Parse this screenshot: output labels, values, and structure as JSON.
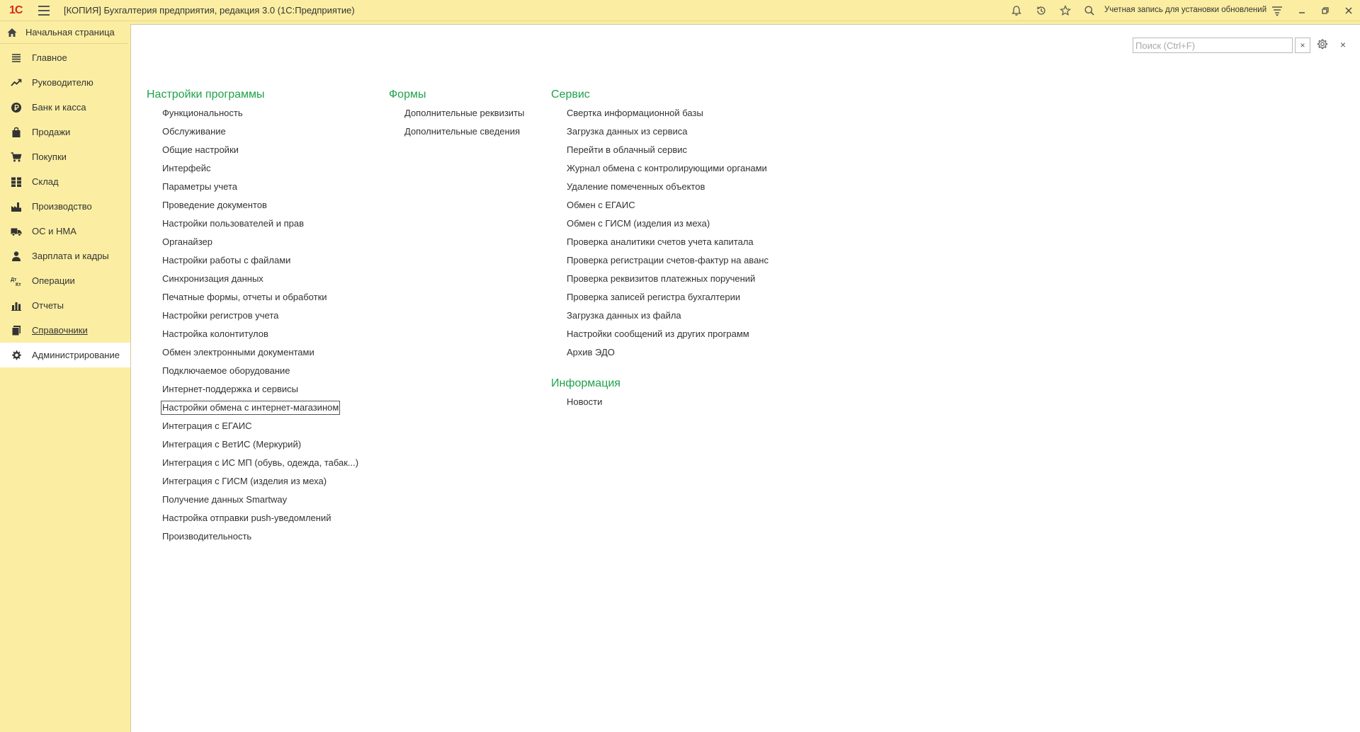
{
  "titlebar": {
    "logo": "1С",
    "title": "[КОПИЯ] Бухгалтерия предприятия, редакция 3.0  (1С:Предприятие)",
    "account": "Учетная запись для установки обновлений"
  },
  "home": {
    "label": "Начальная страница"
  },
  "sidebar": {
    "items": [
      {
        "label": "Главное",
        "icon": "menu-lines-icon"
      },
      {
        "label": "Руководителю",
        "icon": "trend-up-icon"
      },
      {
        "label": "Банк и касса",
        "icon": "ruble-coin-icon"
      },
      {
        "label": "Продажи",
        "icon": "shopping-bag-icon"
      },
      {
        "label": "Покупки",
        "icon": "cart-icon"
      },
      {
        "label": "Склад",
        "icon": "warehouse-grid-icon"
      },
      {
        "label": "Производство",
        "icon": "factory-icon"
      },
      {
        "label": "ОС и НМА",
        "icon": "truck-icon"
      },
      {
        "label": "Зарплата и кадры",
        "icon": "person-icon"
      },
      {
        "label": "Операции",
        "icon": "dt-kt-icon"
      },
      {
        "label": "Отчеты",
        "icon": "bar-chart-icon"
      },
      {
        "label": "Справочники",
        "icon": "books-icon"
      },
      {
        "label": "Администрирование",
        "icon": "gear-icon"
      }
    ],
    "active_index": 12
  },
  "panel": {
    "search_placeholder": "Поиск (Ctrl+F)",
    "search_value": "",
    "clear_symbol": "×",
    "close_symbol": "×"
  },
  "sections": {
    "settings": {
      "title": "Настройки программы",
      "items": [
        "Функциональность",
        "Обслуживание",
        "Общие настройки",
        "Интерфейс",
        "Параметры учета",
        "Проведение документов",
        "Настройки пользователей и прав",
        "Органайзер",
        "Настройки работы с файлами",
        "Синхронизация данных",
        "Печатные формы, отчеты и обработки",
        "Настройки регистров учета",
        "Настройка колонтитулов",
        "Обмен электронными документами",
        "Подключаемое оборудование",
        "Интернет-поддержка и сервисы",
        "Настройки обмена с интернет-магазином",
        "Интеграция с ЕГАИС",
        "Интеграция с ВетИС (Меркурий)",
        "Интеграция с ИС МП (обувь, одежда, табак...)",
        "Интеграция с ГИСМ (изделия из меха)",
        "Получение данных Smartway",
        "Настройка отправки push-уведомлений",
        "Производительность"
      ],
      "focused_index": 16
    },
    "forms": {
      "title": "Формы",
      "items": [
        "Дополнительные реквизиты",
        "Дополнительные сведения"
      ]
    },
    "service": {
      "title": "Сервис",
      "items": [
        "Свертка информационной базы",
        "Загрузка данных из сервиса",
        "Перейти в облачный сервис",
        "Журнал обмена с контролирующими органами",
        "Удаление помеченных объектов",
        "Обмен с ЕГАИС",
        "Обмен с ГИСМ (изделия из меха)",
        "Проверка аналитики счетов учета капитала",
        "Проверка регистрации счетов-фактур на аванс",
        "Проверка реквизитов платежных поручений",
        "Проверка записей регистра бухгалтерии",
        "Загрузка данных из файла",
        "Настройки сообщений из других программ",
        "Архив ЭДО"
      ]
    },
    "info": {
      "title": "Информация",
      "items": [
        "Новости"
      ]
    }
  },
  "colors": {
    "background": "#fbeea2",
    "section_title": "#1fa24a",
    "logo": "#d52b1e",
    "panel": "#ffffff"
  }
}
